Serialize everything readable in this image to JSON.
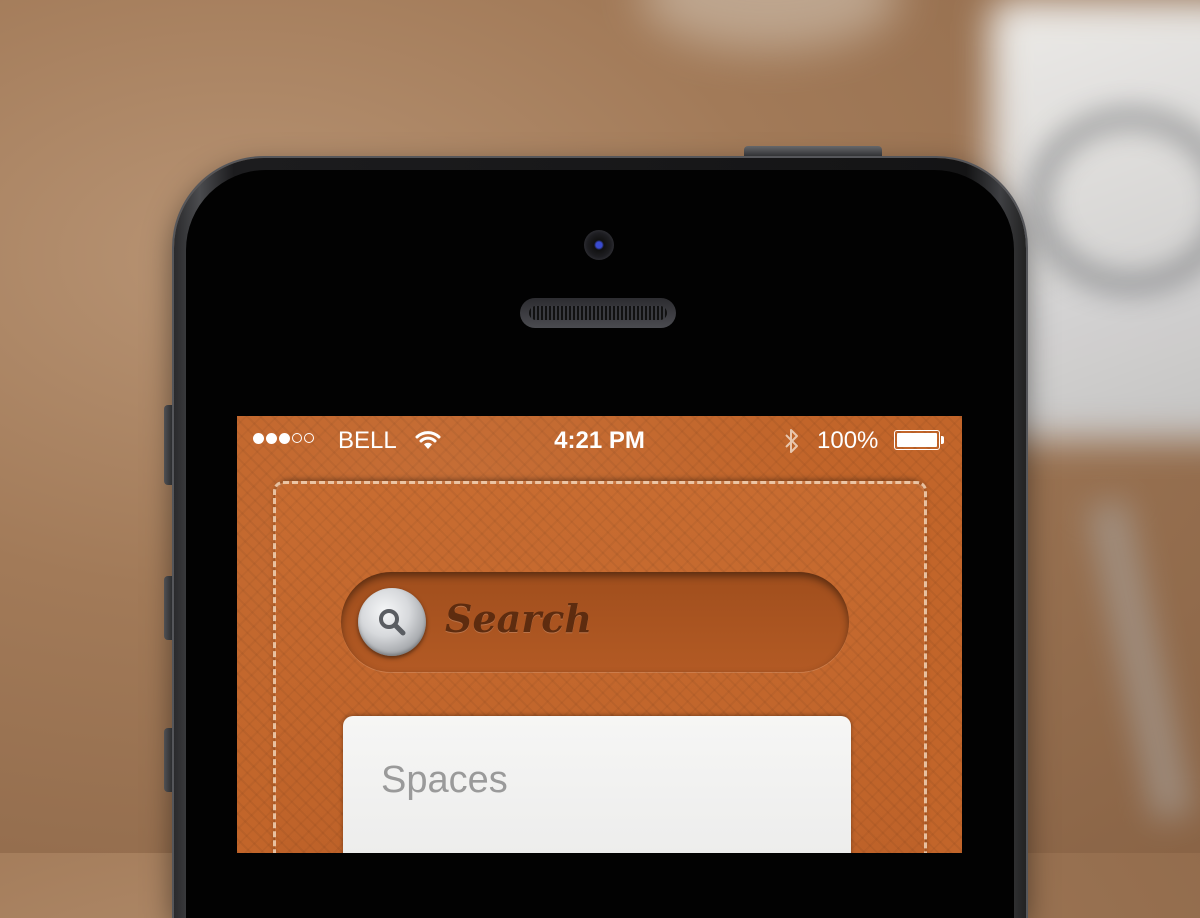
{
  "status_bar": {
    "signal_full": 3,
    "signal_total": 5,
    "carrier": "BELL",
    "time": "4:21 PM",
    "battery_percent": "100%",
    "battery_level": 1.0,
    "icons": [
      "wifi-icon",
      "bluetooth-icon",
      "battery-icon"
    ]
  },
  "search": {
    "label": "Search",
    "icon": "magnifier-icon"
  },
  "card": {
    "title": "Spaces"
  },
  "colors": {
    "leather": "#c2652a",
    "search_text": "#5e2c0f",
    "card_background": "#f2f2f1",
    "card_title": "#9a9a9a"
  }
}
